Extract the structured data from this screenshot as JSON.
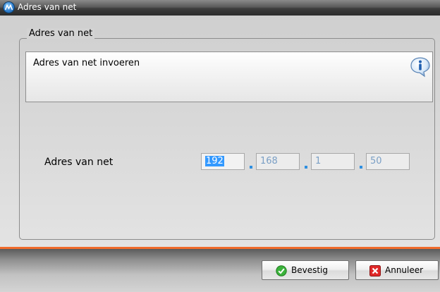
{
  "window": {
    "title": "Adres van net"
  },
  "group": {
    "legend": "Adres van net"
  },
  "info": {
    "text": "Adres van net invoeren",
    "icon": "info-icon"
  },
  "field": {
    "label": "Adres van net",
    "octets": [
      "192",
      "168",
      "1",
      "50"
    ]
  },
  "buttons": {
    "confirm_label": "Bevestig",
    "cancel_label": "Annuleer"
  },
  "colors": {
    "accent_line": "#f06a2a",
    "selection": "#3399ff",
    "confirm_icon": "#3bb33b",
    "cancel_icon": "#e02828"
  }
}
